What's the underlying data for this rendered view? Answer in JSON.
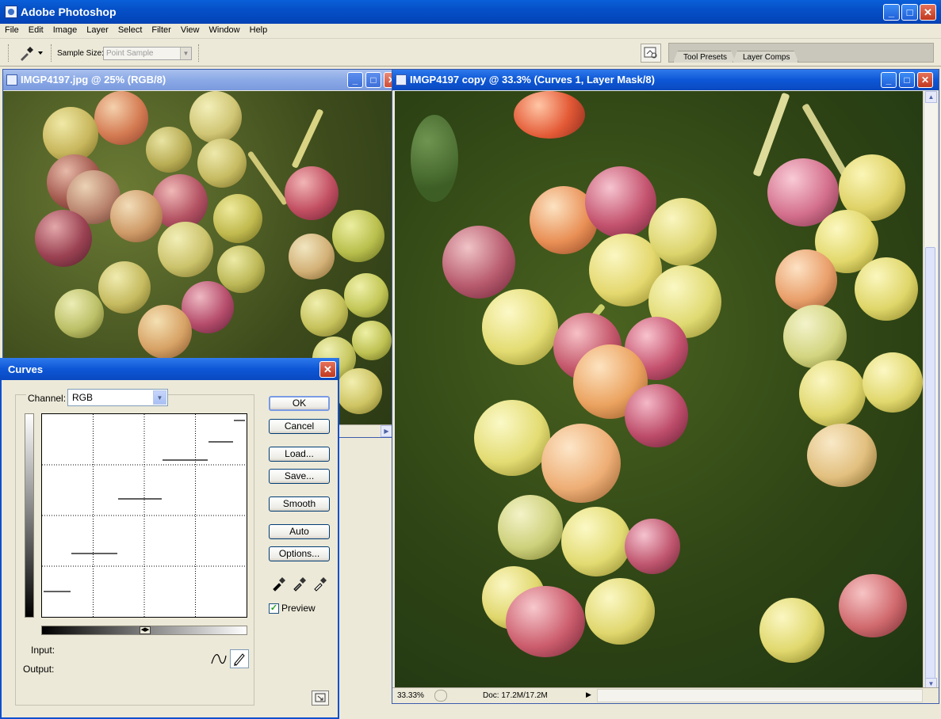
{
  "app": {
    "title": "Adobe Photoshop"
  },
  "menu": [
    "File",
    "Edit",
    "Image",
    "Layer",
    "Select",
    "Filter",
    "View",
    "Window",
    "Help"
  ],
  "options_bar": {
    "sample_size_label": "Sample Size:",
    "sample_size_value": "Point Sample"
  },
  "palette_well": {
    "tabs": [
      "Tool Presets",
      "Layer Comps"
    ]
  },
  "doc1": {
    "title": "IMGP4197.jpg @ 25% (RGB/8)"
  },
  "doc2": {
    "title": "IMGP4197 copy @ 33.3% (Curves 1, Layer Mask/8)",
    "zoom": "33.33%",
    "doc_size": "Doc: 17.2M/17.2M"
  },
  "curves": {
    "title": "Curves",
    "channel_label": "Channel:",
    "channel_value": "RGB",
    "buttons": {
      "ok": "OK",
      "cancel": "Cancel",
      "load": "Load...",
      "save": "Save...",
      "smooth": "Smooth",
      "auto": "Auto",
      "options": "Options..."
    },
    "preview_label": "Preview",
    "preview_checked": true,
    "input_label": "Input:",
    "output_label": "Output:"
  }
}
